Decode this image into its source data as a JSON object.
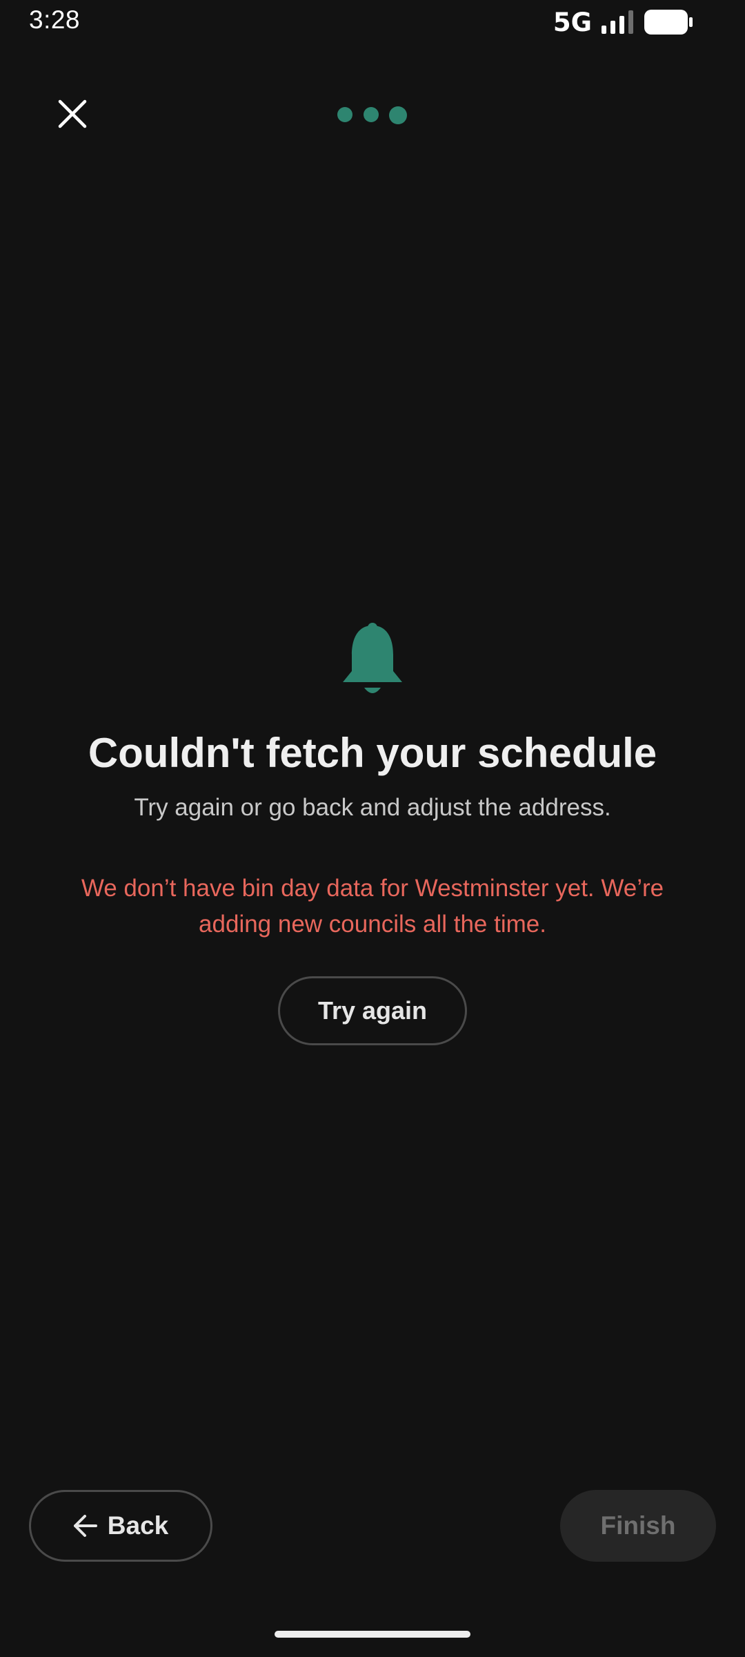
{
  "status_bar": {
    "time": "3:28",
    "network": "5G",
    "icons": [
      "signal-icon",
      "battery-icon"
    ]
  },
  "header": {
    "close_icon": "close-icon",
    "progress": {
      "steps": 3,
      "current": 3
    }
  },
  "error": {
    "icon": "bell-icon",
    "title": "Couldn't fetch your schedule",
    "subtitle": "Try again or go back and adjust the address.",
    "message": "We don’t have bin day data for Westminster yet. We’re adding new councils all the time.",
    "retry_label": "Try again"
  },
  "footer": {
    "back_label": "Back",
    "back_icon": "arrow-left-icon",
    "finish_label": "Finish"
  },
  "colors": {
    "background": "#121212",
    "accent": "#2E8570",
    "error": "#E8675C",
    "text": "#EFEFEF",
    "muted": "#C9C9C9",
    "disabled_bg": "#262626",
    "disabled_text": "#6F6F6F"
  }
}
